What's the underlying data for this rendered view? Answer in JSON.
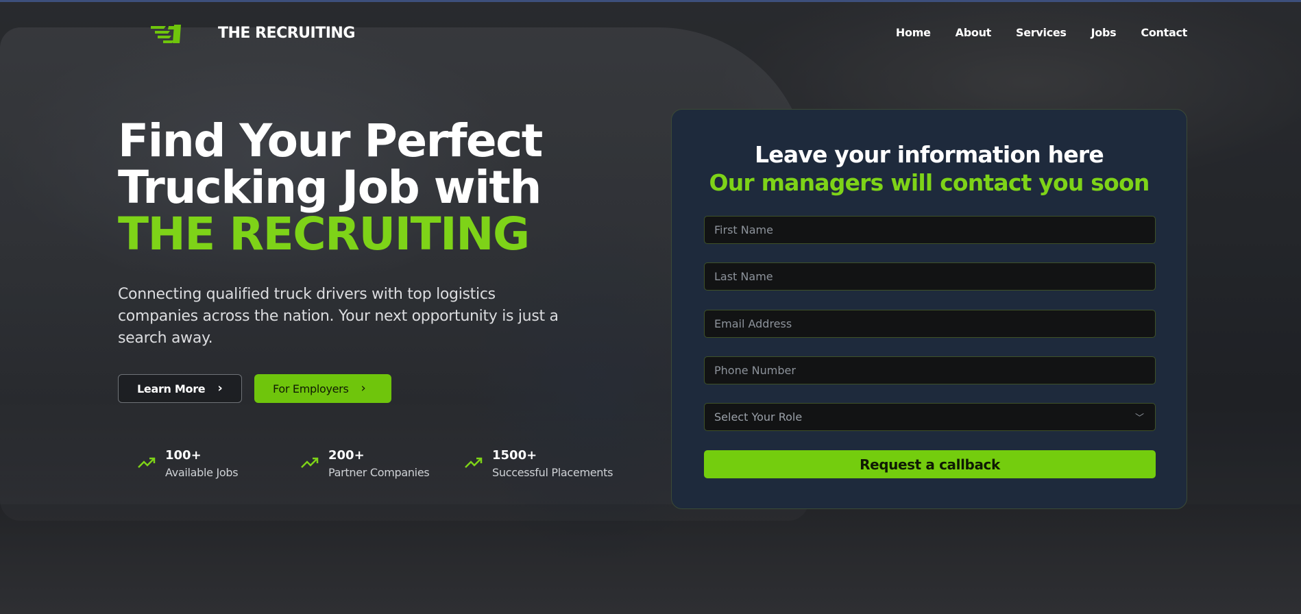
{
  "header": {
    "brand": "THE RECRUITING",
    "logo_icon": "speed-truck-logo-icon",
    "nav": [
      "Home",
      "About",
      "Services",
      "Jobs",
      "Contact"
    ]
  },
  "hero": {
    "headline_line1": "Find Your Perfect",
    "headline_line2": "Trucking Job with",
    "headline_accent": "THE RECRUITING",
    "subtext": "Connecting qualified truck drivers with top logistics companies across the nation. Your next opportunity is just a search away.",
    "learn_more": "Learn More",
    "for_employers": "For Employers"
  },
  "stats": [
    {
      "value": "100+",
      "label": "Available Jobs"
    },
    {
      "value": "200+",
      "label": "Partner Companies"
    },
    {
      "value": "1500+",
      "label": "Successful Placements"
    }
  ],
  "form": {
    "title": "Leave your information here",
    "subtitle": "Our managers will contact you soon",
    "first_name_placeholder": "First Name",
    "last_name_placeholder": "Last Name",
    "email_placeholder": "Email Address",
    "phone_placeholder": "Phone Number",
    "role_placeholder": "Select Your Role",
    "submit": "Request a callback"
  },
  "colors": {
    "accent": "#7ed318",
    "card": "#1e2a3c",
    "topline": "#3d4f7c"
  }
}
